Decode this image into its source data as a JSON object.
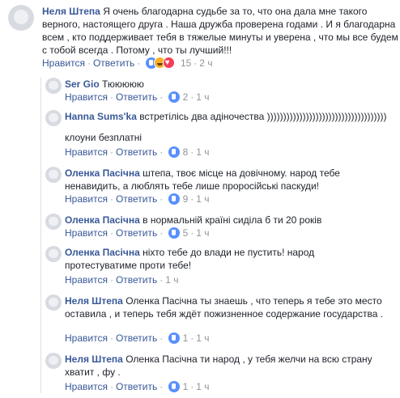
{
  "actions": {
    "like": "Нравится",
    "reply": "Ответить",
    "sep": "·"
  },
  "comments": [
    {
      "author": "Неля Штепа",
      "text": "Я очень благодарна судьбе за то, что она дала мне такого верного, настоящего друга . Наша дружба проверена годами . И я благодарна всем , кто поддерживает тебя в тяжелые минуты и уверена , что мы все будем с тобой всегда . Потому , что ты лучший!!!",
      "reactions": [
        "like",
        "haha",
        "love"
      ],
      "count": "15",
      "time": "2 ч"
    },
    {
      "author": "Ser Gio",
      "text": "Тююююю",
      "reactions": [
        "like"
      ],
      "count": "2",
      "time": "1 ч"
    },
    {
      "author": "Hanna Sums'ka",
      "text": "встретілісь два адіночества )))))))))))))))))))))))))))))))))))))",
      "text2": "клоуни безплатні",
      "reactions": [
        "like"
      ],
      "count": "8",
      "time": "1 ч"
    },
    {
      "author": "Оленка Пасічна",
      "text": "штепа, твоє місце на довічному. народ тебе ненавидить, а люблять тебе лише проросійські паскуди!",
      "reactions": [
        "like"
      ],
      "count": "9",
      "time": "1 ч"
    },
    {
      "author": "Оленка Пасічна",
      "text": "в нормальній країні сиділа б ти 20 років",
      "reactions": [
        "like"
      ],
      "count": "5",
      "time": "1 ч"
    },
    {
      "author": "Оленка Пасічна",
      "text": "ніхто тебе до влади не пустить! народ протестуватиме проти тебе!",
      "reactions": [],
      "count": "",
      "time": "1 ч"
    },
    {
      "author": "Неля Штепа",
      "text": "Оленка Пасічна ты знаешь , что теперь я тебе это место оставила , и теперь тебя ждёт пожизненное содержание государства .",
      "reactions": [
        "like"
      ],
      "count": "1",
      "time": "1 ч"
    },
    {
      "author": "Неля Штепа",
      "text": "Оленка Пасічна ти народ , у тебя желчи на всю страну хватит , фу .",
      "reactions": [
        "like"
      ],
      "count": "1",
      "time": "1 ч"
    }
  ]
}
